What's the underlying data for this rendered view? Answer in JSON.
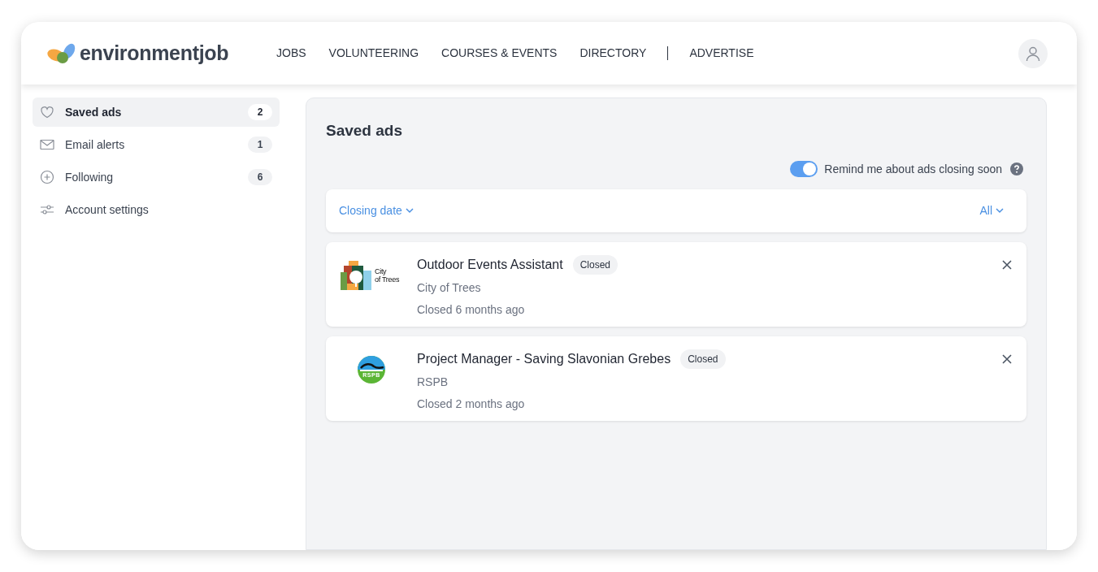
{
  "brand": "environmentjob",
  "nav": [
    {
      "label": "JOBS",
      "kind": "link"
    },
    {
      "label": "VOLUNTEERING",
      "kind": "link"
    },
    {
      "label": "COURSES & EVENTS",
      "kind": "link"
    },
    {
      "label": "DIRECTORY",
      "kind": "link"
    },
    {
      "label": "ADVERTISE",
      "kind": "link"
    }
  ],
  "sidebar": {
    "items": [
      {
        "label": "Saved ads",
        "kind": "heart",
        "count": "2",
        "selected": true
      },
      {
        "label": "Email alerts",
        "kind": "mail",
        "count": "1",
        "selected": false
      },
      {
        "label": "Following",
        "kind": "plus",
        "count": "6",
        "selected": false
      },
      {
        "label": "Account settings",
        "kind": "sliders",
        "selected": false
      }
    ]
  },
  "main": {
    "title": "Saved ads",
    "reminder": {
      "label": "Remind me about ads closing soon",
      "on": true
    },
    "filters": {
      "sort": "Closing date",
      "show": "All"
    },
    "ads": [
      {
        "title": "Outdoor Events Assistant",
        "status": "Closed",
        "employer": "City of Trees",
        "closed": "Closed 6 months ago",
        "kind": "trees",
        "logo_text": [
          "City",
          "of Trees"
        ]
      },
      {
        "title": "Project Manager - Saving Slavonian Grebes",
        "status": "Closed",
        "employer": "RSPB",
        "closed": "Closed 2 months ago",
        "kind": "rspb",
        "logo_text": [
          "RSPB"
        ]
      }
    ]
  }
}
